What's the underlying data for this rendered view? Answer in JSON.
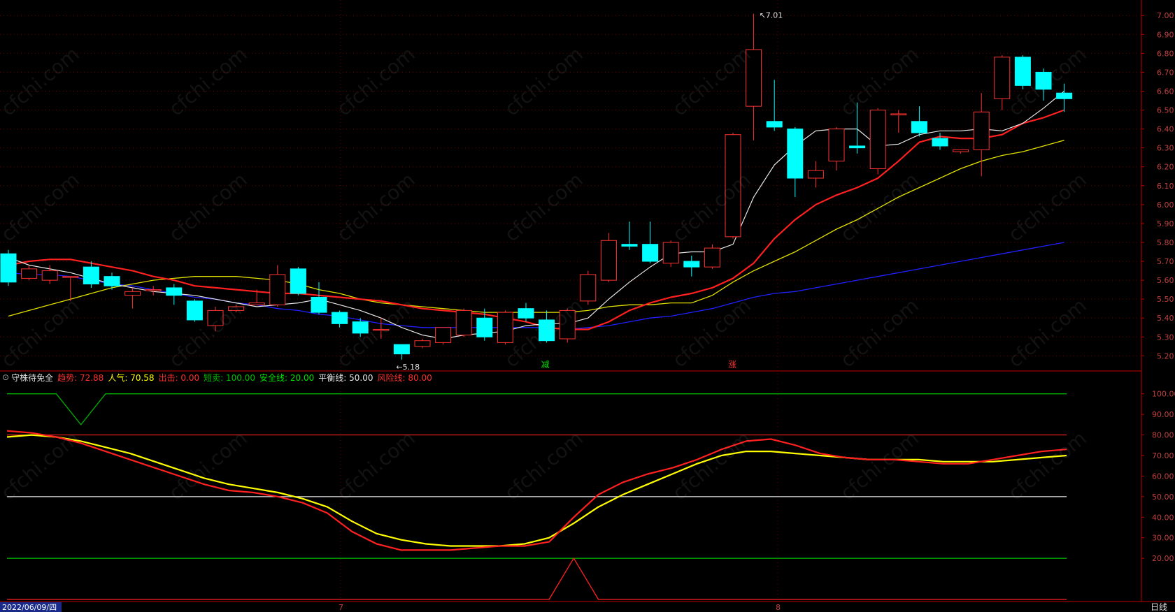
{
  "colors": {
    "background": "#000000",
    "up_candle": "#ff3232",
    "down_candle": "#00ffff",
    "ma5": "#e8e8e8",
    "ma10": "#ff2020",
    "ma20": "#e0e000",
    "ma60": "#2020ff",
    "axis_red": "#c00000",
    "grid": "#6b0000"
  },
  "price_panel": {
    "ylim": [
      5.12,
      7.06
    ],
    "y_ticks": [
      "7.00",
      "6.90",
      "6.80",
      "6.70",
      "6.60",
      "6.50",
      "6.40",
      "6.30",
      "6.20",
      "6.10",
      "6.00",
      "5.90",
      "5.80",
      "5.70",
      "5.60",
      "5.50",
      "5.40",
      "5.30",
      "5.20"
    ],
    "high_annotation": "7.01",
    "low_annotation": "5.18",
    "signal_reduce": "减",
    "signal_rise": "涨"
  },
  "chart_data": [
    {
      "type": "candlestick",
      "candles": [
        [
          5.74,
          5.59,
          5.76,
          5.57
        ],
        [
          5.61,
          5.66,
          5.68,
          5.6
        ],
        [
          5.6,
          5.65,
          5.68,
          5.58
        ],
        [
          5.62,
          5.62,
          5.62,
          5.49
        ],
        [
          5.67,
          5.58,
          5.7,
          5.56
        ],
        [
          5.62,
          5.57,
          5.64,
          5.55
        ],
        [
          5.52,
          5.54,
          5.56,
          5.45
        ],
        [
          5.55,
          5.55,
          5.57,
          5.52
        ],
        [
          5.56,
          5.52,
          5.58,
          5.47
        ],
        [
          5.49,
          5.39,
          5.5,
          5.38
        ],
        [
          5.36,
          5.44,
          5.46,
          5.33
        ],
        [
          5.44,
          5.46,
          5.47,
          5.43
        ],
        [
          5.47,
          5.48,
          5.55,
          5.47
        ],
        [
          5.47,
          5.63,
          5.68,
          5.46
        ],
        [
          5.66,
          5.53,
          5.67,
          5.52
        ],
        [
          5.51,
          5.43,
          5.59,
          5.42
        ],
        [
          5.43,
          5.37,
          5.44,
          5.35
        ],
        [
          5.38,
          5.32,
          5.4,
          5.3
        ],
        [
          5.34,
          5.34,
          5.4,
          5.29
        ],
        [
          5.26,
          5.21,
          5.26,
          5.18
        ],
        [
          5.25,
          5.28,
          5.29,
          5.24
        ],
        [
          5.27,
          5.35,
          5.35,
          5.26
        ],
        [
          5.31,
          5.44,
          5.45,
          5.3
        ],
        [
          5.4,
          5.3,
          5.45,
          5.28
        ],
        [
          5.27,
          5.43,
          5.44,
          5.26
        ],
        [
          5.45,
          5.4,
          5.48,
          5.38
        ],
        [
          5.39,
          5.28,
          5.44,
          5.27
        ],
        [
          5.29,
          5.44,
          5.45,
          5.27
        ],
        [
          5.49,
          5.63,
          5.65,
          5.47
        ],
        [
          5.6,
          5.81,
          5.85,
          5.59
        ],
        [
          5.79,
          5.78,
          5.91,
          5.76
        ],
        [
          5.79,
          5.7,
          5.91,
          5.69
        ],
        [
          5.69,
          5.8,
          5.81,
          5.67
        ],
        [
          5.7,
          5.67,
          5.73,
          5.62
        ],
        [
          5.67,
          5.77,
          5.79,
          5.66
        ],
        [
          5.83,
          6.37,
          6.38,
          5.82
        ],
        [
          6.52,
          6.82,
          7.01,
          6.34
        ],
        [
          6.44,
          6.41,
          6.66,
          6.39
        ],
        [
          6.4,
          6.14,
          6.41,
          6.04
        ],
        [
          6.14,
          6.18,
          6.23,
          6.09
        ],
        [
          6.23,
          6.4,
          6.41,
          6.18
        ],
        [
          6.31,
          6.3,
          6.54,
          6.27
        ],
        [
          6.19,
          6.5,
          6.51,
          6.16
        ],
        [
          6.48,
          6.48,
          6.5,
          6.38
        ],
        [
          6.44,
          6.38,
          6.52,
          6.36
        ],
        [
          6.35,
          6.31,
          6.38,
          6.29
        ],
        [
          6.28,
          6.29,
          6.29,
          6.27
        ],
        [
          6.29,
          6.49,
          6.59,
          6.15
        ],
        [
          6.56,
          6.78,
          6.79,
          6.5
        ],
        [
          6.78,
          6.63,
          6.79,
          6.61
        ],
        [
          6.7,
          6.61,
          6.72,
          6.55
        ],
        [
          6.59,
          6.56,
          6.64,
          6.49
        ]
      ],
      "ma5": [
        5.72,
        5.68,
        5.66,
        5.64,
        5.61,
        5.58,
        5.56,
        5.54,
        5.53,
        5.52,
        5.5,
        5.48,
        5.46,
        5.47,
        5.48,
        5.5,
        5.47,
        5.44,
        5.4,
        5.35,
        5.31,
        5.29,
        5.31,
        5.32,
        5.33,
        5.36,
        5.37,
        5.37,
        5.4,
        5.5,
        5.59,
        5.67,
        5.74,
        5.75,
        5.75,
        5.79,
        6.04,
        6.21,
        6.31,
        6.39,
        6.4,
        6.4,
        6.31,
        6.32,
        6.37,
        6.39,
        6.39,
        6.4,
        6.39,
        6.43,
        6.51,
        6.6
      ],
      "ma10": [
        5.68,
        5.7,
        5.71,
        5.71,
        5.69,
        5.67,
        5.65,
        5.62,
        5.6,
        5.57,
        5.56,
        5.55,
        5.54,
        5.53,
        5.53,
        5.52,
        5.51,
        5.5,
        5.49,
        5.47,
        5.45,
        5.44,
        5.43,
        5.42,
        5.4,
        5.38,
        5.35,
        5.34,
        5.34,
        5.38,
        5.44,
        5.48,
        5.51,
        5.53,
        5.56,
        5.61,
        5.69,
        5.82,
        5.92,
        6.0,
        6.05,
        6.09,
        6.14,
        6.23,
        6.33,
        6.36,
        6.35,
        6.35,
        6.37,
        6.43,
        6.46,
        6.5
      ],
      "ma20": [
        5.41,
        5.44,
        5.47,
        5.5,
        5.53,
        5.56,
        5.58,
        5.6,
        5.61,
        5.62,
        5.62,
        5.62,
        5.61,
        5.6,
        5.58,
        5.55,
        5.53,
        5.5,
        5.48,
        5.47,
        5.46,
        5.45,
        5.44,
        5.43,
        5.43,
        5.43,
        5.43,
        5.43,
        5.44,
        5.46,
        5.47,
        5.47,
        5.48,
        5.48,
        5.52,
        5.59,
        5.65,
        5.7,
        5.75,
        5.81,
        5.87,
        5.92,
        5.98,
        6.04,
        6.09,
        6.14,
        6.19,
        6.23,
        6.26,
        6.28,
        6.31,
        6.34
      ],
      "ma60": [
        5.64,
        5.63,
        5.63,
        5.62,
        5.6,
        5.58,
        5.57,
        5.55,
        5.53,
        5.51,
        5.5,
        5.48,
        5.47,
        5.45,
        5.44,
        5.42,
        5.41,
        5.39,
        5.37,
        5.36,
        5.35,
        5.35,
        5.35,
        5.35,
        5.35,
        5.35,
        5.35,
        5.34,
        5.35,
        5.36,
        5.38,
        5.4,
        5.41,
        5.43,
        5.45,
        5.48,
        5.51,
        5.53,
        5.54,
        5.56,
        5.58,
        5.6,
        5.62,
        5.64,
        5.66,
        5.68,
        5.7,
        5.72,
        5.74,
        5.76,
        5.78,
        5.8
      ]
    },
    {
      "type": "line",
      "title": "守株待免全",
      "ylim": [
        0,
        105
      ],
      "y_ticks": [
        "100.00",
        "90.00",
        "80.00",
        "70.00",
        "60.00",
        "50.00",
        "40.00",
        "30.00",
        "20.00"
      ],
      "series": [
        {
          "name": "趋势",
          "value": "72.88",
          "color": "#ff2020",
          "values": [
            82,
            81,
            79,
            76,
            72,
            68,
            64,
            60,
            56,
            53,
            52,
            50,
            47,
            42,
            33,
            27,
            24,
            24,
            24,
            25,
            26,
            26,
            28,
            40,
            51,
            57,
            61,
            64,
            68,
            73,
            77,
            78,
            75,
            71,
            69,
            68,
            68,
            67,
            66,
            66,
            68,
            70,
            72,
            73
          ]
        },
        {
          "name": "人气",
          "value": "70.58",
          "color": "#ffff00",
          "values": [
            79,
            80,
            79,
            77,
            74,
            71,
            67,
            63,
            59,
            56,
            54,
            52,
            49,
            45,
            38,
            32,
            29,
            27,
            26,
            26,
            26,
            27,
            30,
            37,
            45,
            51,
            56,
            61,
            66,
            70,
            72,
            72,
            71,
            70,
            69,
            68,
            68,
            68,
            67,
            67,
            67,
            68,
            69,
            70
          ]
        },
        {
          "name": "出击",
          "value": "0.00",
          "color": "#ff2020",
          "values": [
            0,
            0,
            0,
            0,
            0,
            0,
            0,
            0,
            0,
            0,
            0,
            0,
            0,
            0,
            0,
            0,
            0,
            0,
            0,
            0,
            0,
            0,
            0,
            20,
            0,
            0,
            0,
            0,
            0,
            0,
            0,
            0,
            0,
            0,
            0,
            0,
            0,
            0,
            0,
            0,
            0,
            0,
            0,
            0
          ]
        },
        {
          "name": "短卖",
          "value": "100.00",
          "color": "#00b000",
          "values": [
            100,
            100,
            100,
            85,
            100,
            100,
            100,
            100,
            100,
            100,
            100,
            100,
            100,
            100,
            100,
            100,
            100,
            100,
            100,
            100,
            100,
            100,
            100,
            100,
            100,
            100,
            100,
            100,
            100,
            100,
            100,
            100,
            100,
            100,
            100,
            100,
            100,
            100,
            100,
            100,
            100,
            100,
            100,
            100
          ]
        }
      ],
      "reference_lines": [
        {
          "name": "安全线",
          "value": "20.00",
          "color": "#00c000"
        },
        {
          "name": "平衡线",
          "value": "50.00",
          "color": "#e8e8e8"
        },
        {
          "name": "风险线",
          "value": "80.00",
          "color": "#ff2020"
        }
      ]
    }
  ],
  "x_axis": {
    "date": "2022/06/09/四",
    "month_labels": [
      "7",
      "8"
    ],
    "period": "日线"
  }
}
